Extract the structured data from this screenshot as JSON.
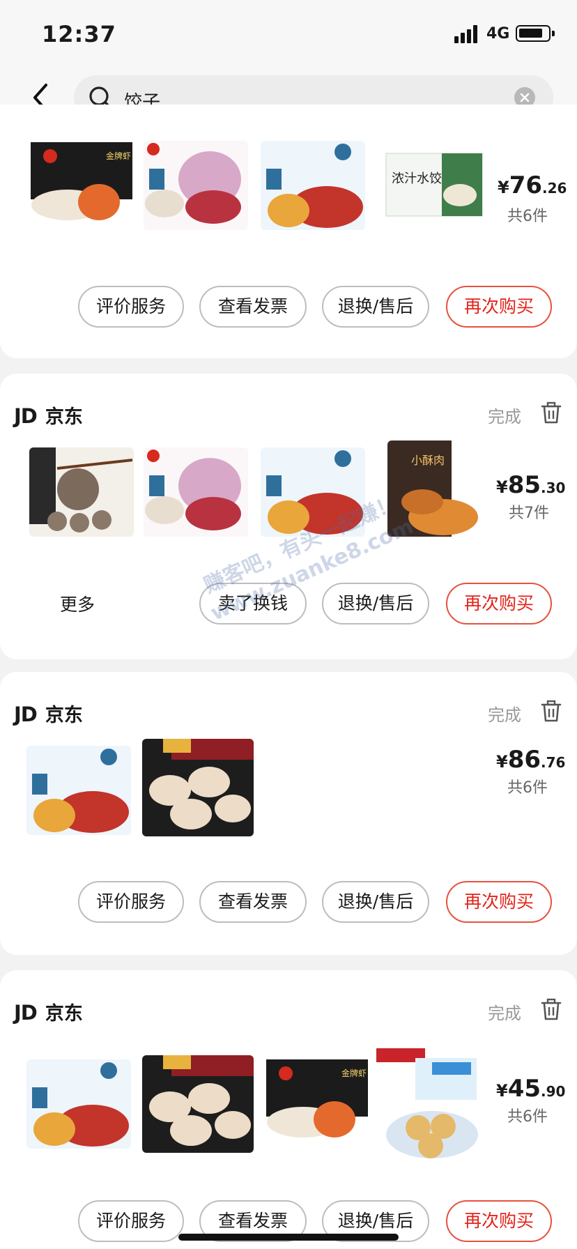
{
  "status_bar": {
    "time": "12:37",
    "network": "4G"
  },
  "search": {
    "query": "饺子"
  },
  "orders": [
    {
      "shop": "",
      "status": "",
      "images": [
        "金牌虾 dumplings",
        "牛肉 水饺",
        "虾 水饺",
        "浓汁水饺"
      ],
      "thumb_texts": [
        "金牌虾",
        "",
        "",
        "浓汁水饺"
      ],
      "price_symbol": "¥",
      "price_int": "76",
      "price_dec": ".26",
      "count": "共6件",
      "buttons": [
        "评价服务",
        "查看发票",
        "退换/售后",
        "再次购买"
      ],
      "more": ""
    },
    {
      "shop": "京东",
      "status": "完成",
      "images": [
        "牛肉丸",
        "牛肉 水饺",
        "虾 水饺",
        "小酥肉"
      ],
      "thumb_texts": [
        "",
        "",
        "",
        "小酥肉"
      ],
      "price_symbol": "¥",
      "price_int": "85",
      "price_dec": ".30",
      "count": "共7件",
      "buttons": [
        "卖了换钱",
        "退换/售后",
        "再次购买"
      ],
      "more": "更多"
    },
    {
      "shop": "京东",
      "status": "完成",
      "images": [
        "虾 水饺",
        "蒸饺"
      ],
      "thumb_texts": [
        "",
        ""
      ],
      "price_symbol": "¥",
      "price_int": "86",
      "price_dec": ".76",
      "count": "共6件",
      "buttons": [
        "评价服务",
        "查看发票",
        "退换/售后",
        "再次购买"
      ],
      "more": ""
    },
    {
      "shop": "京东",
      "status": "完成",
      "images": [
        "虾 水饺",
        "蒸饺",
        "金牌虾 dumplings",
        "糯米团"
      ],
      "thumb_texts": [
        "",
        "",
        "金牌虾",
        ""
      ],
      "price_symbol": "¥",
      "price_int": "45",
      "price_dec": ".90",
      "count": "共6件",
      "buttons": [
        "评价服务",
        "查看发票",
        "退换/售后",
        "再次购买"
      ],
      "more": ""
    }
  ],
  "jd_logo": "JD",
  "watermark": [
    "赚客吧，有头一起赚！",
    "www.zuanke8.com"
  ],
  "colors": {
    "accent_red": "#e2231a",
    "page_bg": "#f2f2f2"
  }
}
